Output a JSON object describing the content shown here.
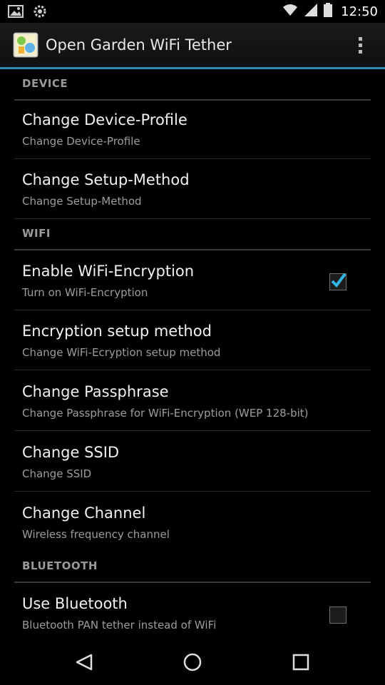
{
  "status_bar": {
    "time": "12:50",
    "icons": [
      "image-icon",
      "settings-icon",
      "wifi-icon",
      "signal-icon",
      "battery-icon"
    ]
  },
  "action_bar": {
    "title": "Open Garden WiFi Tether",
    "app_icon": "open-garden-icon",
    "overflow_icon": "overflow-menu-icon"
  },
  "sections": {
    "device": {
      "title": "DEVICE"
    },
    "wifi": {
      "title": "WIFI"
    },
    "bluetooth": {
      "title": "BLUETOOTH"
    }
  },
  "prefs": {
    "device_profile": {
      "title": "Change Device-Profile",
      "summary": "Change Device-Profile"
    },
    "setup_method": {
      "title": "Change Setup-Method",
      "summary": "Change Setup-Method"
    },
    "wifi_encryption": {
      "title": "Enable WiFi-Encryption",
      "summary": "Turn on WiFi-Encryption",
      "checked": true
    },
    "encryption_method": {
      "title": "Encryption setup method",
      "summary": "Change WiFi-Ecryption setup method"
    },
    "passphrase": {
      "title": "Change Passphrase",
      "summary": "Change Passphrase for WiFi-Encryption (WEP 128-bit)"
    },
    "ssid": {
      "title": "Change SSID",
      "summary": "Change SSID"
    },
    "channel": {
      "title": "Change Channel",
      "summary": "Wireless frequency channel"
    },
    "bluetooth": {
      "title": "Use Bluetooth",
      "summary": "Bluetooth PAN tether instead of WiFi",
      "checked": false
    }
  },
  "colors": {
    "accent": "#2a8fb3",
    "check": "#33b5e5",
    "background": "#000000"
  },
  "nav_bar": {
    "icons": [
      "back-icon",
      "home-icon",
      "recents-icon"
    ]
  }
}
